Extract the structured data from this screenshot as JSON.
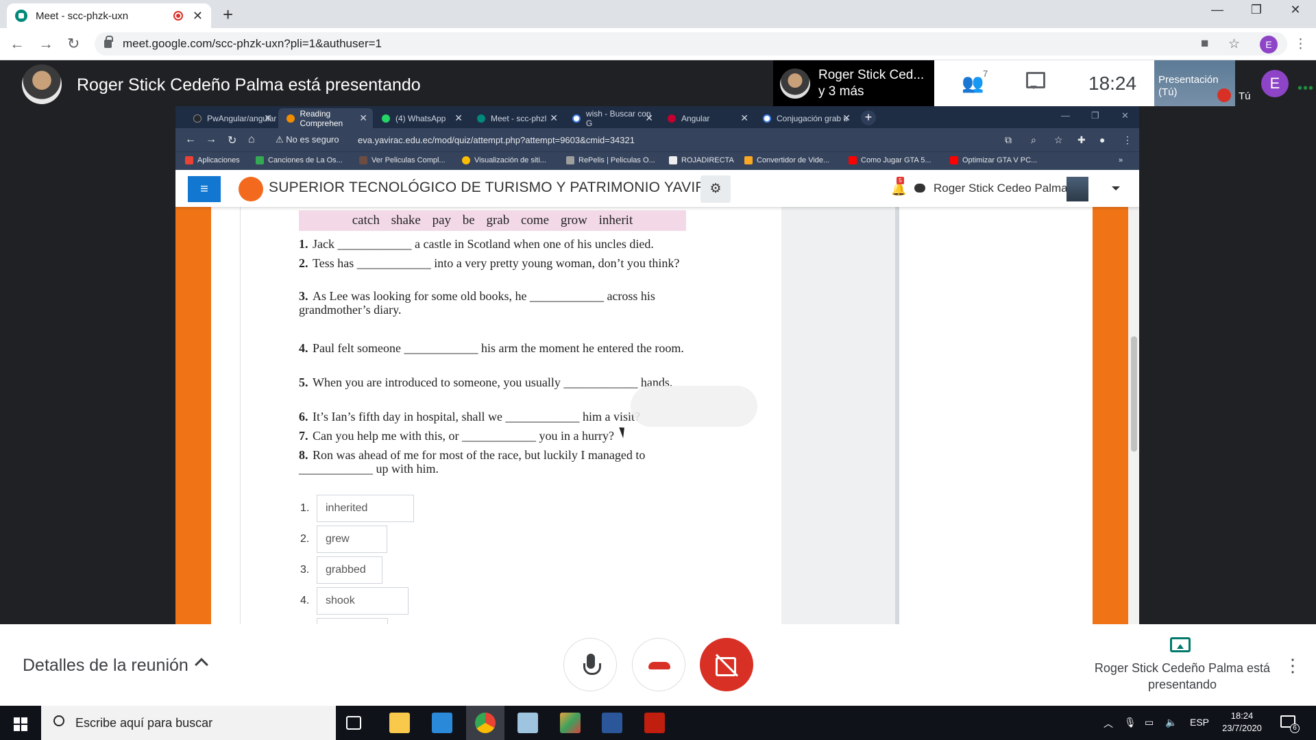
{
  "browser": {
    "tab_title": "Meet - scc-phzk-uxn",
    "new_tab": "+",
    "url": "meet.google.com/scc-phzk-uxn?pli=1&authuser=1",
    "profile_initial": "E"
  },
  "meet": {
    "presenting_banner": "Roger Stick Cedeño Palma está presentando",
    "presenter_name_line1": "Roger Stick Ced...",
    "presenter_name_line2": "y 3 más",
    "participants_count": "7",
    "time": "18:24",
    "self_label": "Presentación (Tú)",
    "self_you": "Tú",
    "self_initial": "E",
    "details_label": "Detalles de la reunión",
    "present_status": "Roger Stick Cedeño Palma está presentando"
  },
  "shared": {
    "tabs": [
      {
        "label": "PwAngular/angular",
        "color": "#24292e"
      },
      {
        "label": "Reading Comprehen",
        "color": "#f28c00"
      },
      {
        "label": "(4) WhatsApp",
        "color": "#25d366"
      },
      {
        "label": "Meet - scc-phzl",
        "color": "#00897b"
      },
      {
        "label": "wish - Buscar con G",
        "color": "#ffffff"
      },
      {
        "label": "Angular",
        "color": "#c3002f"
      },
      {
        "label": "Conjugación grab u",
        "color": "#ffffff"
      }
    ],
    "security_warning": "No es seguro",
    "url": "eva.yavirac.edu.ec/mod/quiz/attempt.php?attempt=9603&cmid=34321",
    "bookmarks": [
      {
        "label": "Aplicaciones",
        "color": "#ea4335"
      },
      {
        "label": "Canciones de La Os...",
        "color": "#34a853"
      },
      {
        "label": "Ver Peliculas Compl...",
        "color": "#6d4c41"
      },
      {
        "label": "Visualización de siti...",
        "color": "#fbbc04"
      },
      {
        "label": "RePelis | Peliculas O...",
        "color": "#9e9e9e"
      },
      {
        "label": "ROJADIRECTA",
        "color": "#eeeeee"
      },
      {
        "label": "Convertidor de Vide...",
        "color": "#f9a825"
      },
      {
        "label": "Como Jugar GTA 5...",
        "color": "#ff0000"
      },
      {
        "label": "Optimizar GTA V PC...",
        "color": "#ff0000"
      }
    ],
    "bookmarks_more": "»",
    "site_title": "SUPERIOR TECNOLÓGICO DE TURISMO Y PATRIMONIO YAVIRAC",
    "notification_count": "5",
    "user_name": "Roger Stick Cedeo Palma"
  },
  "quiz": {
    "word_bank": "catch shake pay be grab come grow inherit",
    "questions": [
      {
        "n": "1.",
        "text": "Jack ____________ a castle in Scotland when one of his uncles died."
      },
      {
        "n": "2.",
        "text": "Tess has ____________ into a very pretty young woman, don’t you think?"
      },
      {
        "n": "3.",
        "text": "As Lee was looking for some old books, he ____________ across his grandmother’s diary."
      },
      {
        "n": "4.",
        "text": "Paul felt someone ____________ his arm the moment he entered the room."
      },
      {
        "n": "5.",
        "text": "When you are introduced to someone, you usually ____________ hands."
      },
      {
        "n": "6.",
        "text": "It’s Ian’s fifth day in hospital, shall we ____________ him a visit?"
      },
      {
        "n": "7.",
        "text": "Can you help me with this, or ____________ you in a hurry?"
      },
      {
        "n": "8.",
        "text": "Ron was ahead of me for most of the race, but luckily I managed to ____________ up with him."
      }
    ],
    "answers": [
      {
        "n": "1.",
        "value": "inherited"
      },
      {
        "n": "2.",
        "value": "grew"
      },
      {
        "n": "3.",
        "value": "grabbed"
      },
      {
        "n": "4.",
        "value": "shook"
      }
    ]
  },
  "taskbar": {
    "search_placeholder": "Escribe aquí para buscar",
    "language": "ESP",
    "time": "18:24",
    "date": "23/7/2020",
    "notifications": "6"
  }
}
